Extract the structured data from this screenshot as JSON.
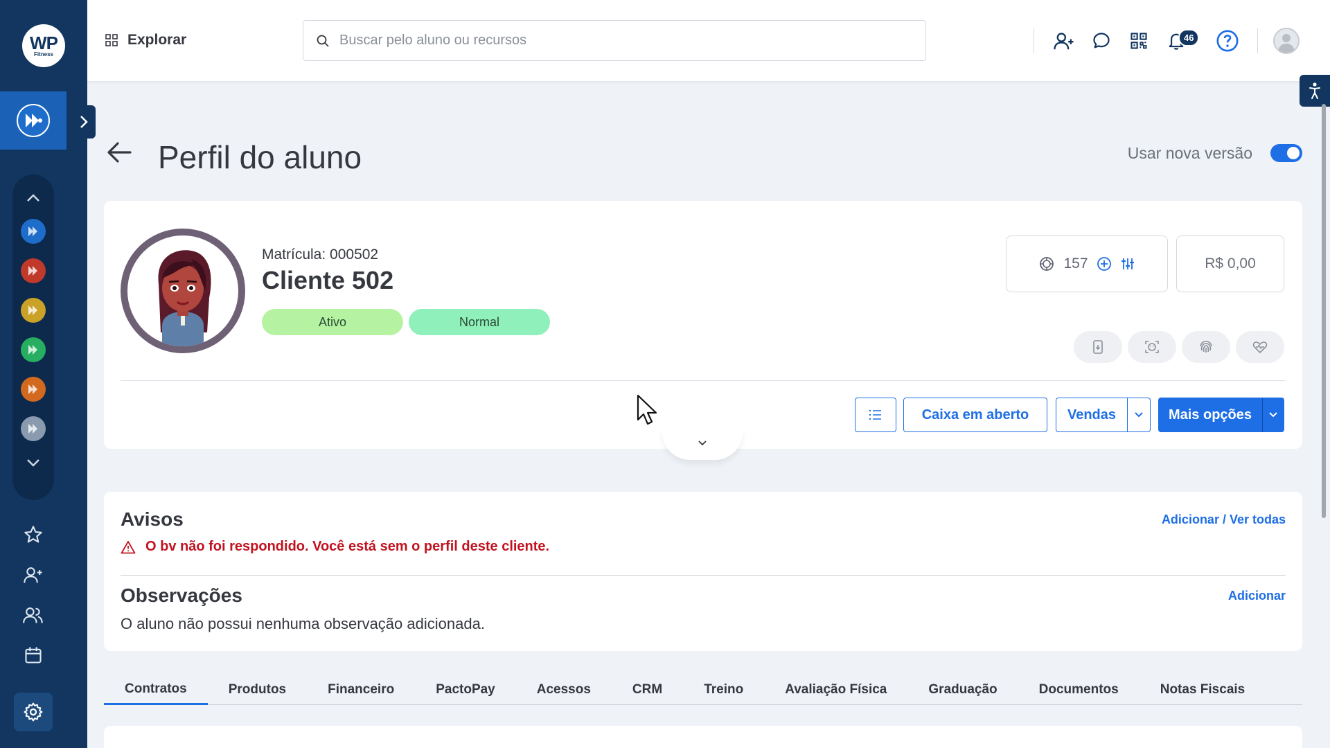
{
  "logo": {
    "main": "WP",
    "sub": "Fitness"
  },
  "topbar": {
    "explore_label": "Explorar",
    "search_placeholder": "Buscar pelo aluno ou recursos",
    "notifications_count": "46"
  },
  "page": {
    "title": "Perfil do aluno",
    "new_version_label": "Usar nova versão",
    "new_version_enabled": true
  },
  "profile": {
    "matricula": "Matrícula: 000502",
    "name": "Cliente 502",
    "status_tags": [
      "Ativo",
      "Normal"
    ],
    "points": "157",
    "balance": "R$ 0,00"
  },
  "actions": {
    "caixa": "Caixa em aberto",
    "vendas": "Vendas",
    "mais": "Mais opções"
  },
  "avisos": {
    "title": "Avisos",
    "link": "Adicionar / Ver todas",
    "warning": "O bv não foi respondido. Você está sem o perfil deste cliente."
  },
  "observacoes": {
    "title": "Observações",
    "link": "Adicionar",
    "empty_text": "O aluno não possui nenhuma observação adicionada."
  },
  "tabs": [
    {
      "label": "Contratos",
      "active": true
    },
    {
      "label": "Produtos"
    },
    {
      "label": "Financeiro"
    },
    {
      "label": "PactoPay"
    },
    {
      "label": "Acessos"
    },
    {
      "label": "CRM"
    },
    {
      "label": "Treino"
    },
    {
      "label": "Avaliação Física"
    },
    {
      "label": "Graduação"
    },
    {
      "label": "Documentos"
    },
    {
      "label": "Notas Fiscais"
    }
  ],
  "colors": {
    "sidebar": "#12365f",
    "accent": "#1e6ee6",
    "warning": "#c1121f",
    "module_dots": [
      "#1f6dca",
      "#c0392b",
      "#c9a227",
      "#27ae60",
      "#d2691e",
      "#8a9bb0"
    ]
  }
}
